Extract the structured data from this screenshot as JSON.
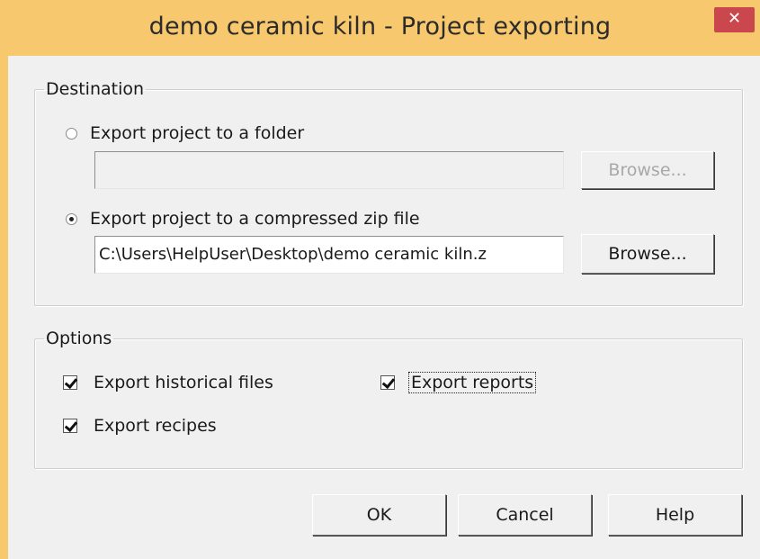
{
  "window": {
    "title": "demo ceramic kiln - Project exporting",
    "close_glyph": "✕"
  },
  "destination": {
    "legend": "Destination",
    "folder_option": {
      "label": "Export project to a folder",
      "selected": false
    },
    "folder_path": "",
    "folder_browse_label": "Browse...",
    "zip_option": {
      "label": "Export project to a compressed zip file",
      "selected": true
    },
    "zip_path": "C:\\Users\\HelpUser\\Desktop\\demo ceramic kiln.z",
    "zip_browse_label": "Browse..."
  },
  "options": {
    "legend": "Options",
    "historical": {
      "label": "Export historical files",
      "checked": true
    },
    "recipes": {
      "label": "Export recipes",
      "checked": true
    },
    "reports": {
      "label": "Export reports",
      "checked": true
    }
  },
  "buttons": {
    "ok": "OK",
    "cancel": "Cancel",
    "help": "Help"
  },
  "colors": {
    "titlebar": "#f7c86d",
    "close_button": "#c9474d",
    "client_bg": "#f0f0f0"
  }
}
